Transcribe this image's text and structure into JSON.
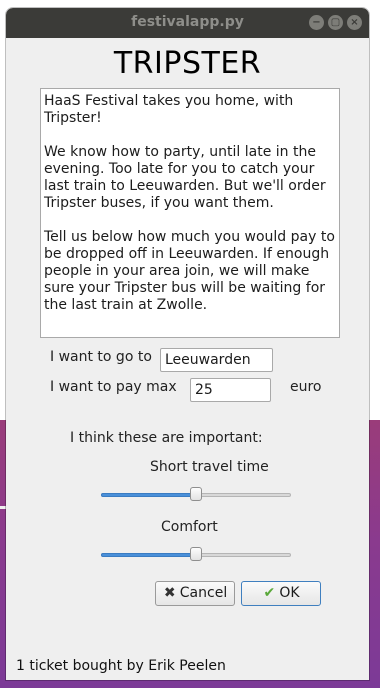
{
  "window": {
    "title": "festivalapp.py",
    "controls": {
      "minimize": "−",
      "maximize": "▢",
      "close": "×"
    }
  },
  "app": {
    "heading": "TRIPSTER",
    "intro_paragraphs": [
      "HaaS Festival takes you home, with Tripster!",
      "We know how to party, until late in the evening. Too late for you to catch your last train to Leeuwarden. But we'll order Tripster buses, if you want them.",
      "Tell us below how much you would pay to be dropped off in Leeuwarden. If enough people in your area join, we will make sure your Tripster bus will be waiting for the last train at Zwolle."
    ]
  },
  "form": {
    "destination_label": "I want to go to",
    "destination_value": "Leeuwarden",
    "price_label": "I want to pay max",
    "price_value": "25",
    "price_unit": "euro",
    "importance_heading": "I think these are important:",
    "sliders": [
      {
        "label": "Short travel time",
        "value_fraction": 0.5
      },
      {
        "label": "Comfort",
        "value_fraction": 0.5
      }
    ]
  },
  "buttons": {
    "cancel": "Cancel",
    "cancel_icon": "x-icon",
    "ok": "OK",
    "ok_icon": "check-icon"
  },
  "statusbar": {
    "text": "1 ticket bought by Erik Peelen"
  },
  "colors": {
    "desktop": "#8a3a8e",
    "titlebar": "#3b3b38",
    "slider_fill": "#4a90d9"
  }
}
